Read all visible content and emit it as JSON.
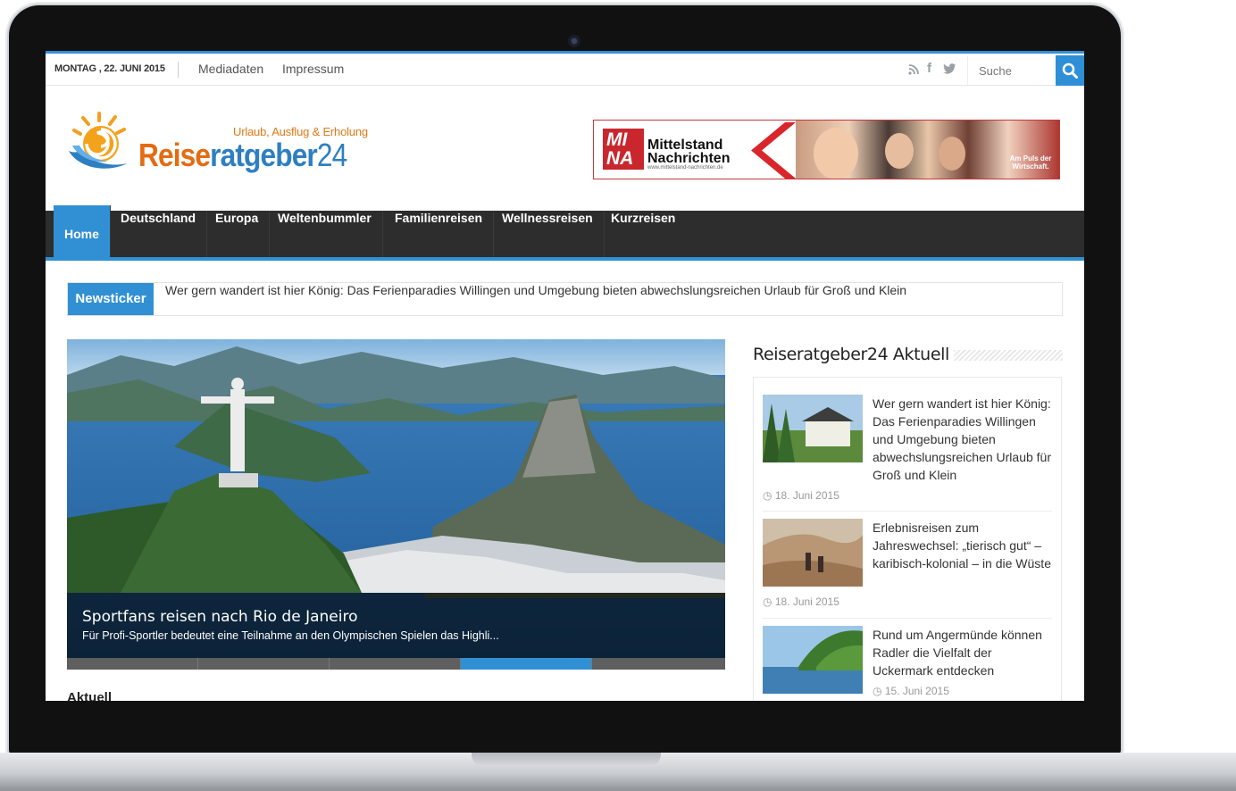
{
  "topbar": {
    "date": "MONTAG , 22. JUNI 2015",
    "links": [
      "Mediadaten",
      "Impressum"
    ],
    "social_icons": [
      "rss-icon",
      "facebook-icon",
      "twitter-icon"
    ],
    "search_placeholder": "Suche"
  },
  "header": {
    "logo_tagline": "Urlaub, Ausflug & Erholung",
    "logo_part1": "Reise",
    "logo_part2": "ratgeber",
    "logo_part3": "24",
    "banner_mark": "MI NA",
    "banner_title_line1": "Mittelstand",
    "banner_title_line2": "Nachrichten",
    "banner_url": "www.mittelstand-nachrichten.de",
    "banner_slogan": "Am Puls der Wirtschaft."
  },
  "nav": {
    "items": [
      "Home",
      "Deutschland",
      "Europa",
      "Weltenbummler",
      "Familienreisen",
      "Wellnessreisen",
      "Kurzreisen"
    ],
    "active": "Home"
  },
  "ticker": {
    "label": "Newsticker",
    "text": "Wer gern wandert ist hier König: Das Ferienparadies Willingen und Umgebung bieten abwechslungsreichen Urlaub für Groß und Klein"
  },
  "slider": {
    "title": "Sportfans reisen nach Rio de Janeiro",
    "excerpt": "Für Profi-Sportler bedeutet eine Teilnahme an den Olympischen Spielen das Highli...",
    "slide_count": 5,
    "active_slide": 4
  },
  "main": {
    "section_peek": "Aktuell"
  },
  "sidebar": {
    "title": "Reiseratgeber24 Aktuell",
    "posts": [
      {
        "title": "Wer gern wandert ist hier König: Das Ferienparadies Willingen und Umgebung bieten abwechslungsreichen Urlaub für Groß und Klein",
        "date": "18. Juni 2015"
      },
      {
        "title": "Erlebnisreisen zum Jahreswechsel: „tierisch gut“ – karibisch-kolonial – in die Wüste",
        "date": "18. Juni 2015"
      },
      {
        "title": "Rund um Angermünde können Radler die Vielfalt der Uckermark entdecken",
        "date": "15. Juni 2015"
      }
    ]
  },
  "colors": {
    "accent": "#3190d4",
    "nav_bg": "#2d2d2d",
    "logo_orange": "#e46b12",
    "logo_blue": "#2d7fc1"
  }
}
